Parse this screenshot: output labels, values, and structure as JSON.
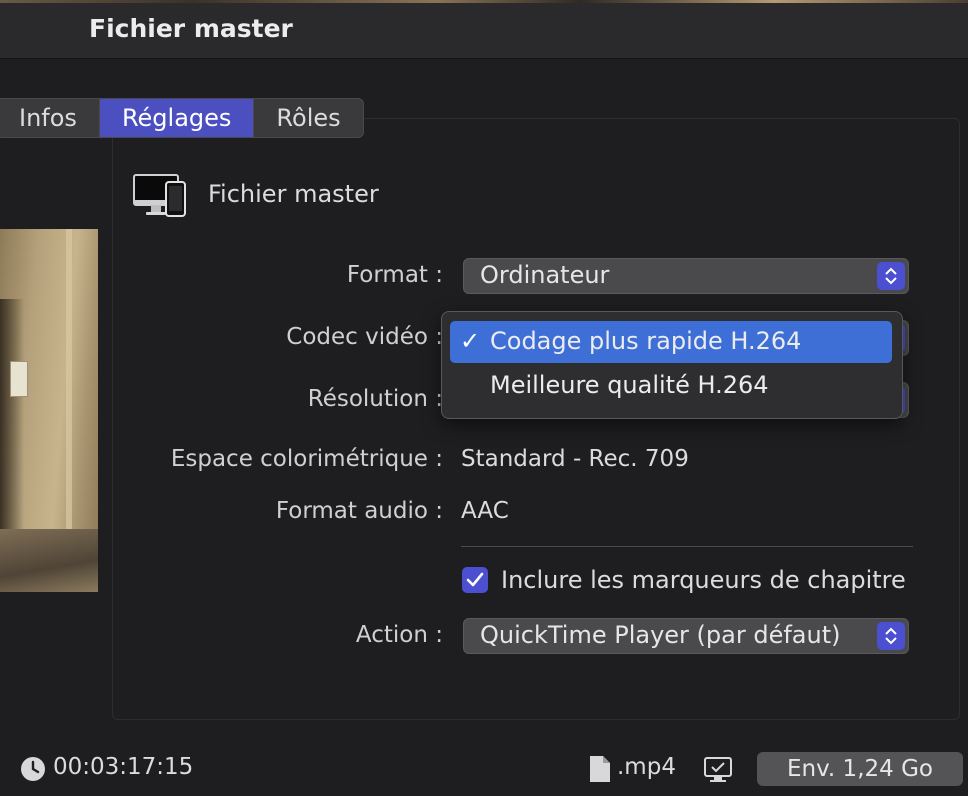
{
  "window": {
    "title": "Fichier master"
  },
  "tabs": [
    {
      "label": "Infos",
      "active": false
    },
    {
      "label": "Réglages",
      "active": true
    },
    {
      "label": "Rôles",
      "active": false
    }
  ],
  "destination": {
    "icon": "computer-and-phone-icon",
    "label": "Fichier master"
  },
  "settings": {
    "format": {
      "label": "Format :",
      "value": "Ordinateur"
    },
    "codec": {
      "label": "Codec vidéo :"
    },
    "resolution": {
      "label": "Résolution :"
    },
    "color_space": {
      "label": "Espace colorimétrique :",
      "value": "Standard - Rec. 709"
    },
    "audio_format": {
      "label": "Format audio :",
      "value": "AAC"
    },
    "chapters": {
      "label": "Inclure les marqueurs de chapitre",
      "checked": true
    },
    "action": {
      "label": "Action :",
      "value": "QuickTime Player (par défaut)"
    }
  },
  "codec_menu": {
    "check_mark": "✓",
    "options": [
      {
        "label": "Codage plus rapide H.264",
        "selected": true
      },
      {
        "label": "Meilleure qualité H.264",
        "selected": false
      }
    ]
  },
  "footer": {
    "duration": "00:03:17:15",
    "extension": ".mp4",
    "size_button": "Env. 1,24 Go"
  },
  "colors": {
    "accent": "#4b4fd0",
    "menu_highlight": "#3d6fd6",
    "background": "#1e1e20"
  }
}
